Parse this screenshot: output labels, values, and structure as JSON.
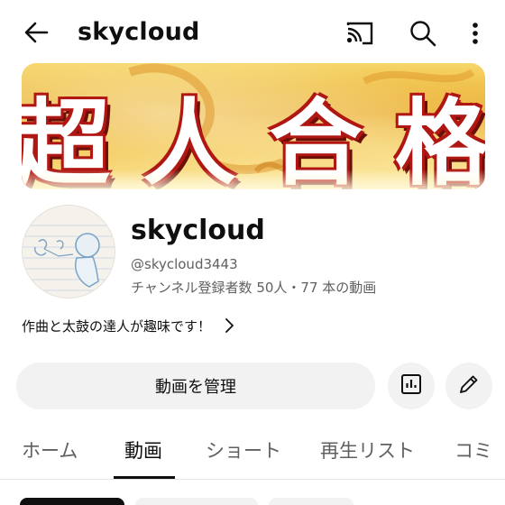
{
  "header": {
    "title": "skycloud",
    "icons": [
      "back-arrow-icon",
      "cast-icon",
      "search-icon",
      "more-vert-icon"
    ]
  },
  "banner": {
    "text": "超人合格"
  },
  "channel": {
    "name": "skycloud",
    "handle": "@skycloud3443",
    "stats": "チャンネル登録者数 50人・77 本の動画",
    "description": "作曲と太鼓の達人が趣味です！"
  },
  "actions": {
    "manage_label": "動画を管理",
    "analytics_icon": "analytics-icon",
    "edit_icon": "edit-pencil-icon"
  },
  "tabs": [
    {
      "label": "ホーム",
      "active": false
    },
    {
      "label": "動画",
      "active": true
    },
    {
      "label": "ショート",
      "active": false
    },
    {
      "label": "再生リスト",
      "active": false
    },
    {
      "label": "コミ",
      "active": false
    }
  ]
}
